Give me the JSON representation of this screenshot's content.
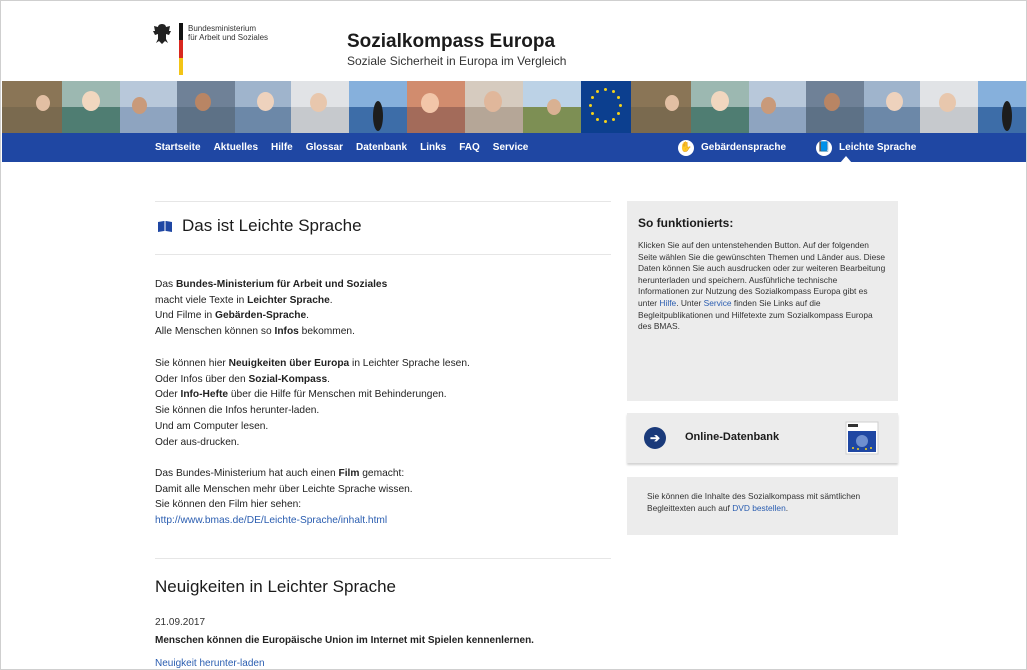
{
  "header": {
    "ministry_line1": "Bundesministerium",
    "ministry_line2": "für Arbeit und Soziales",
    "title": "Sozialkompass Europa",
    "subtitle": "Soziale Sicherheit in Europa im Vergleich"
  },
  "nav": {
    "items": [
      "Startseite",
      "Aktuelles",
      "Hilfe",
      "Glossar",
      "Datenbank",
      "Links",
      "FAQ",
      "Service"
    ],
    "sign_language": "Gebärdensprache",
    "easy_language": "Leichte Sprache"
  },
  "main": {
    "heading": "Das ist Leichte Sprache",
    "intro": {
      "l1_a": "Das ",
      "l1_b": "Bundes-Ministerium für Arbeit und Soziales",
      "l2_a": "macht viele Texte in ",
      "l2_b": "Leichter Sprache",
      "l2_c": ".",
      "l3_a": "Und Filme in ",
      "l3_b": "Gebärden-Sprache",
      "l3_c": ".",
      "l4_a": "Alle Menschen können so ",
      "l4_b": "Infos",
      "l4_c": " bekommen."
    },
    "news_para": {
      "l1_a": "Sie können hier ",
      "l1_b": "Neuigkeiten über Europa",
      "l1_c": " in Leichter Sprache lesen.",
      "l2_a": "Oder Infos über den ",
      "l2_b": "Sozial-Kompass",
      "l2_c": ".",
      "l3_a": "Oder ",
      "l3_b": "Info-Hefte",
      "l3_c": " über die Hilfe für Menschen mit Behinderungen.",
      "l4": "Sie können die Infos herunter-laden.",
      "l5": "Und am Computer lesen.",
      "l6": "Oder aus-drucken."
    },
    "film_para": {
      "l1_a": "Das Bundes-Ministerium hat auch einen ",
      "l1_b": "Film",
      "l1_c": " gemacht:",
      "l2": "Damit alle Menschen mehr über Leichte Sprache wissen.",
      "l3": "Sie können den Film hier sehen:",
      "link": "http://www.bmas.de/DE/Leichte-Sprache/inhalt.html"
    },
    "news_heading": "Neuigkeiten in Leichter Sprache",
    "news_date": "21.09.2017",
    "news_title": "Menschen können die Europäische Union im Internet mit Spielen kennenlernen.",
    "news_download": "Neuigkeit herunter-laden"
  },
  "sidebar": {
    "how_title": "So funktionierts:",
    "how_text_1": "Klicken Sie auf den untenstehenden Button. Auf der folgenden Seite wählen Sie die gewünschten Themen und Länder aus. Diese Daten können Sie auch ausdrucken oder zur weiteren Bearbeitung herunterladen und speichern. Ausführliche technische Informationen zur Nutzung des Sozialkompass Europa gibt es unter ",
    "how_link_help": "Hilfe",
    "how_text_2": ". Unter ",
    "how_link_service": "Service",
    "how_text_3": " finden Sie Links auf die Begleitpublikationen und Hilfetexte zum Sozialkompass Europa des BMAS.",
    "db_button": "Online-Datenbank",
    "dvd_text": "Sie können die Inhalte des Sozialkompass mit sämtlichen Begleittexten auch auf ",
    "dvd_link": "DVD bestellen",
    "dvd_end": "."
  },
  "colors": {
    "nav_blue": "#1f47a3",
    "link_blue": "#2a5db0",
    "box_grey": "#ececec"
  }
}
